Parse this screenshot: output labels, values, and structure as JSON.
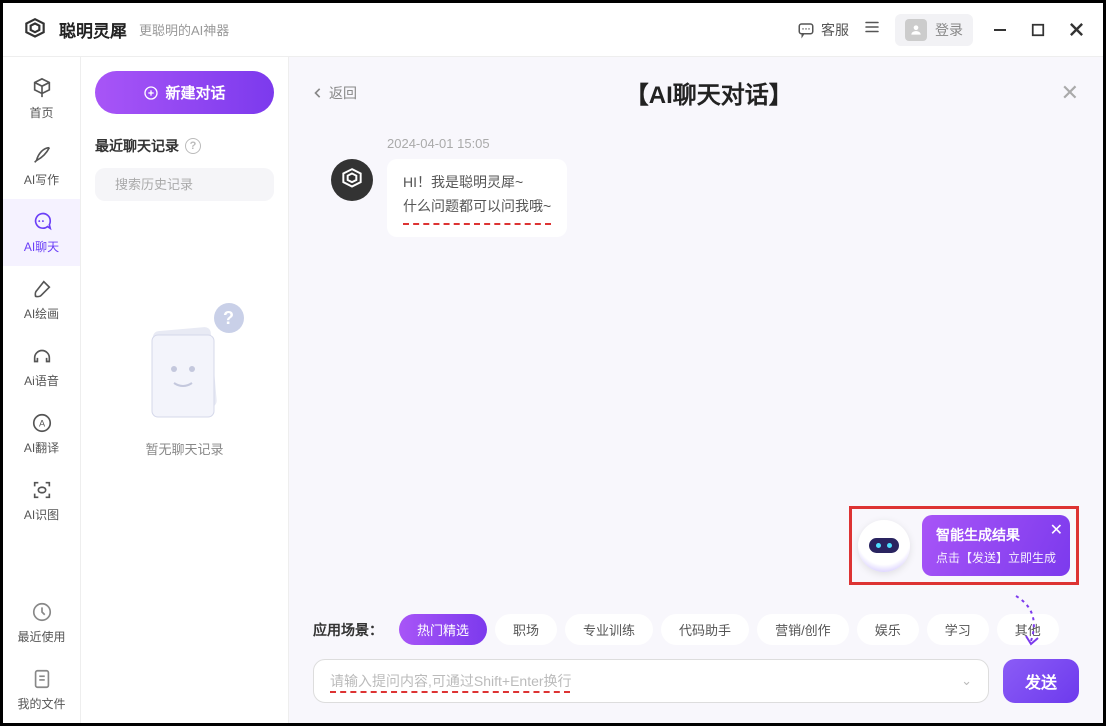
{
  "titlebar": {
    "app_name": "聪明灵犀",
    "subtitle": "更聪明的AI神器",
    "service": "客服",
    "login": "登录"
  },
  "sidenav": {
    "items": [
      {
        "label": "首页"
      },
      {
        "label": "AI写作"
      },
      {
        "label": "AI聊天"
      },
      {
        "label": "AI绘画"
      },
      {
        "label": "Ai语音"
      },
      {
        "label": "AI翻译"
      },
      {
        "label": "AI识图"
      },
      {
        "label": "最近使用"
      },
      {
        "label": "我的文件"
      }
    ]
  },
  "history": {
    "new_chat": "新建对话",
    "header": "最近聊天记录",
    "search_placeholder": "搜索历史记录",
    "empty": "暂无聊天记录"
  },
  "chat": {
    "back": "返回",
    "title": "【AI聊天对话】",
    "timestamp": "2024-04-01 15:05",
    "greeting_line1": "HI！我是聪明灵犀~",
    "greeting_line2": "什么问题都可以问我哦~"
  },
  "tooltip": {
    "title": "智能生成结果",
    "subtitle": "点击【发送】立即生成"
  },
  "input": {
    "scenario_label": "应用场景：",
    "chips": [
      "热门精选",
      "职场",
      "专业训练",
      "代码助手",
      "营销/创作",
      "娱乐",
      "学习",
      "其他"
    ],
    "placeholder": "请输入提问内容,可通过Shift+Enter换行",
    "send": "发送"
  }
}
